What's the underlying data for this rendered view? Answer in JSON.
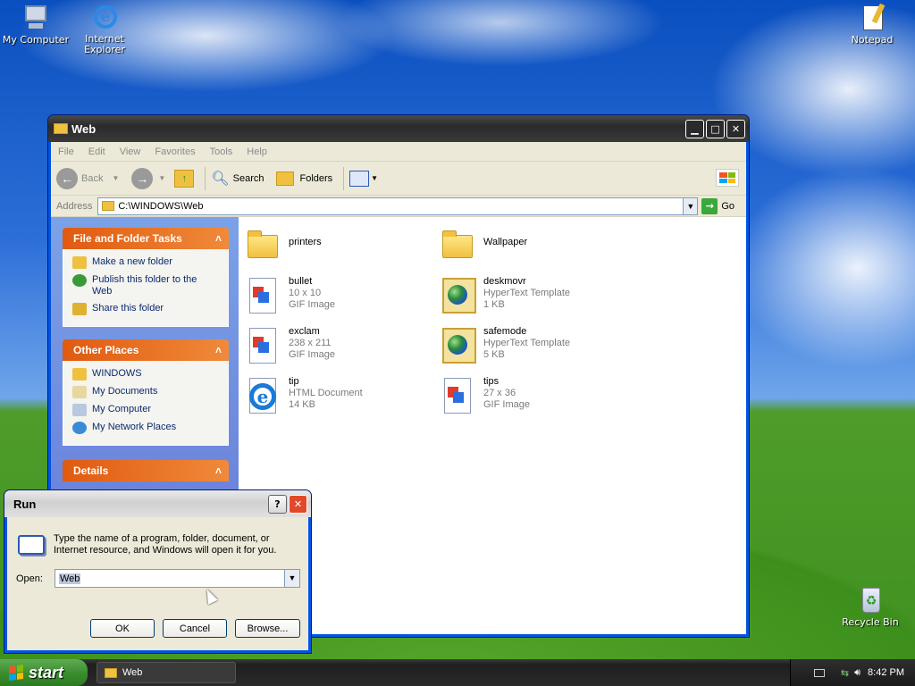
{
  "desktop": {
    "icons": [
      {
        "label": "My Computer"
      },
      {
        "label": "Internet Explorer"
      },
      {
        "label": "Notepad"
      },
      {
        "label": "Recycle Bin"
      }
    ]
  },
  "explorer": {
    "title": "Web",
    "menu": [
      "File",
      "Edit",
      "View",
      "Favorites",
      "Tools",
      "Help"
    ],
    "toolbar": {
      "back": "Back",
      "search": "Search",
      "folders": "Folders"
    },
    "address": {
      "label": "Address",
      "value": "C:\\WINDOWS\\Web",
      "go": "Go"
    },
    "tasks": {
      "file_folder": {
        "title": "File and Folder Tasks",
        "items": [
          "Make a new folder",
          "Publish this folder to the Web",
          "Share this folder"
        ]
      },
      "other_places": {
        "title": "Other Places",
        "items": [
          "WINDOWS",
          "My Documents",
          "My Computer",
          "My Network Places"
        ]
      },
      "details": {
        "title": "Details"
      }
    },
    "files": [
      {
        "name": "printers",
        "type": "",
        "size": "",
        "icon": "folder-icon"
      },
      {
        "name": "Wallpaper",
        "type": "",
        "size": "",
        "icon": "folder-icon"
      },
      {
        "name": "bullet",
        "type": "10 x 10",
        "size": "GIF Image",
        "icon": "gif-icon"
      },
      {
        "name": "deskmovr",
        "type": "HyperText Template",
        "size": "1 KB",
        "icon": "htt-icon"
      },
      {
        "name": "exclam",
        "type": "238 x 211",
        "size": "GIF Image",
        "icon": "gif-icon"
      },
      {
        "name": "safemode",
        "type": "HyperText Template",
        "size": "5 KB",
        "icon": "htt-icon"
      },
      {
        "name": "tip",
        "type": "HTML Document",
        "size": "14 KB",
        "icon": "ie-icon"
      },
      {
        "name": "tips",
        "type": "27 x 36",
        "size": "GIF Image",
        "icon": "gif-icon"
      }
    ]
  },
  "run": {
    "title": "Run",
    "help": "?",
    "description": "Type the name of a program, folder, document, or Internet resource, and Windows will open it for you.",
    "open_label": "Open:",
    "open_value": "Web",
    "ok": "OK",
    "cancel": "Cancel",
    "browse": "Browse..."
  },
  "taskbar": {
    "start": "start",
    "task": "Web",
    "clock": "8:42 PM"
  }
}
